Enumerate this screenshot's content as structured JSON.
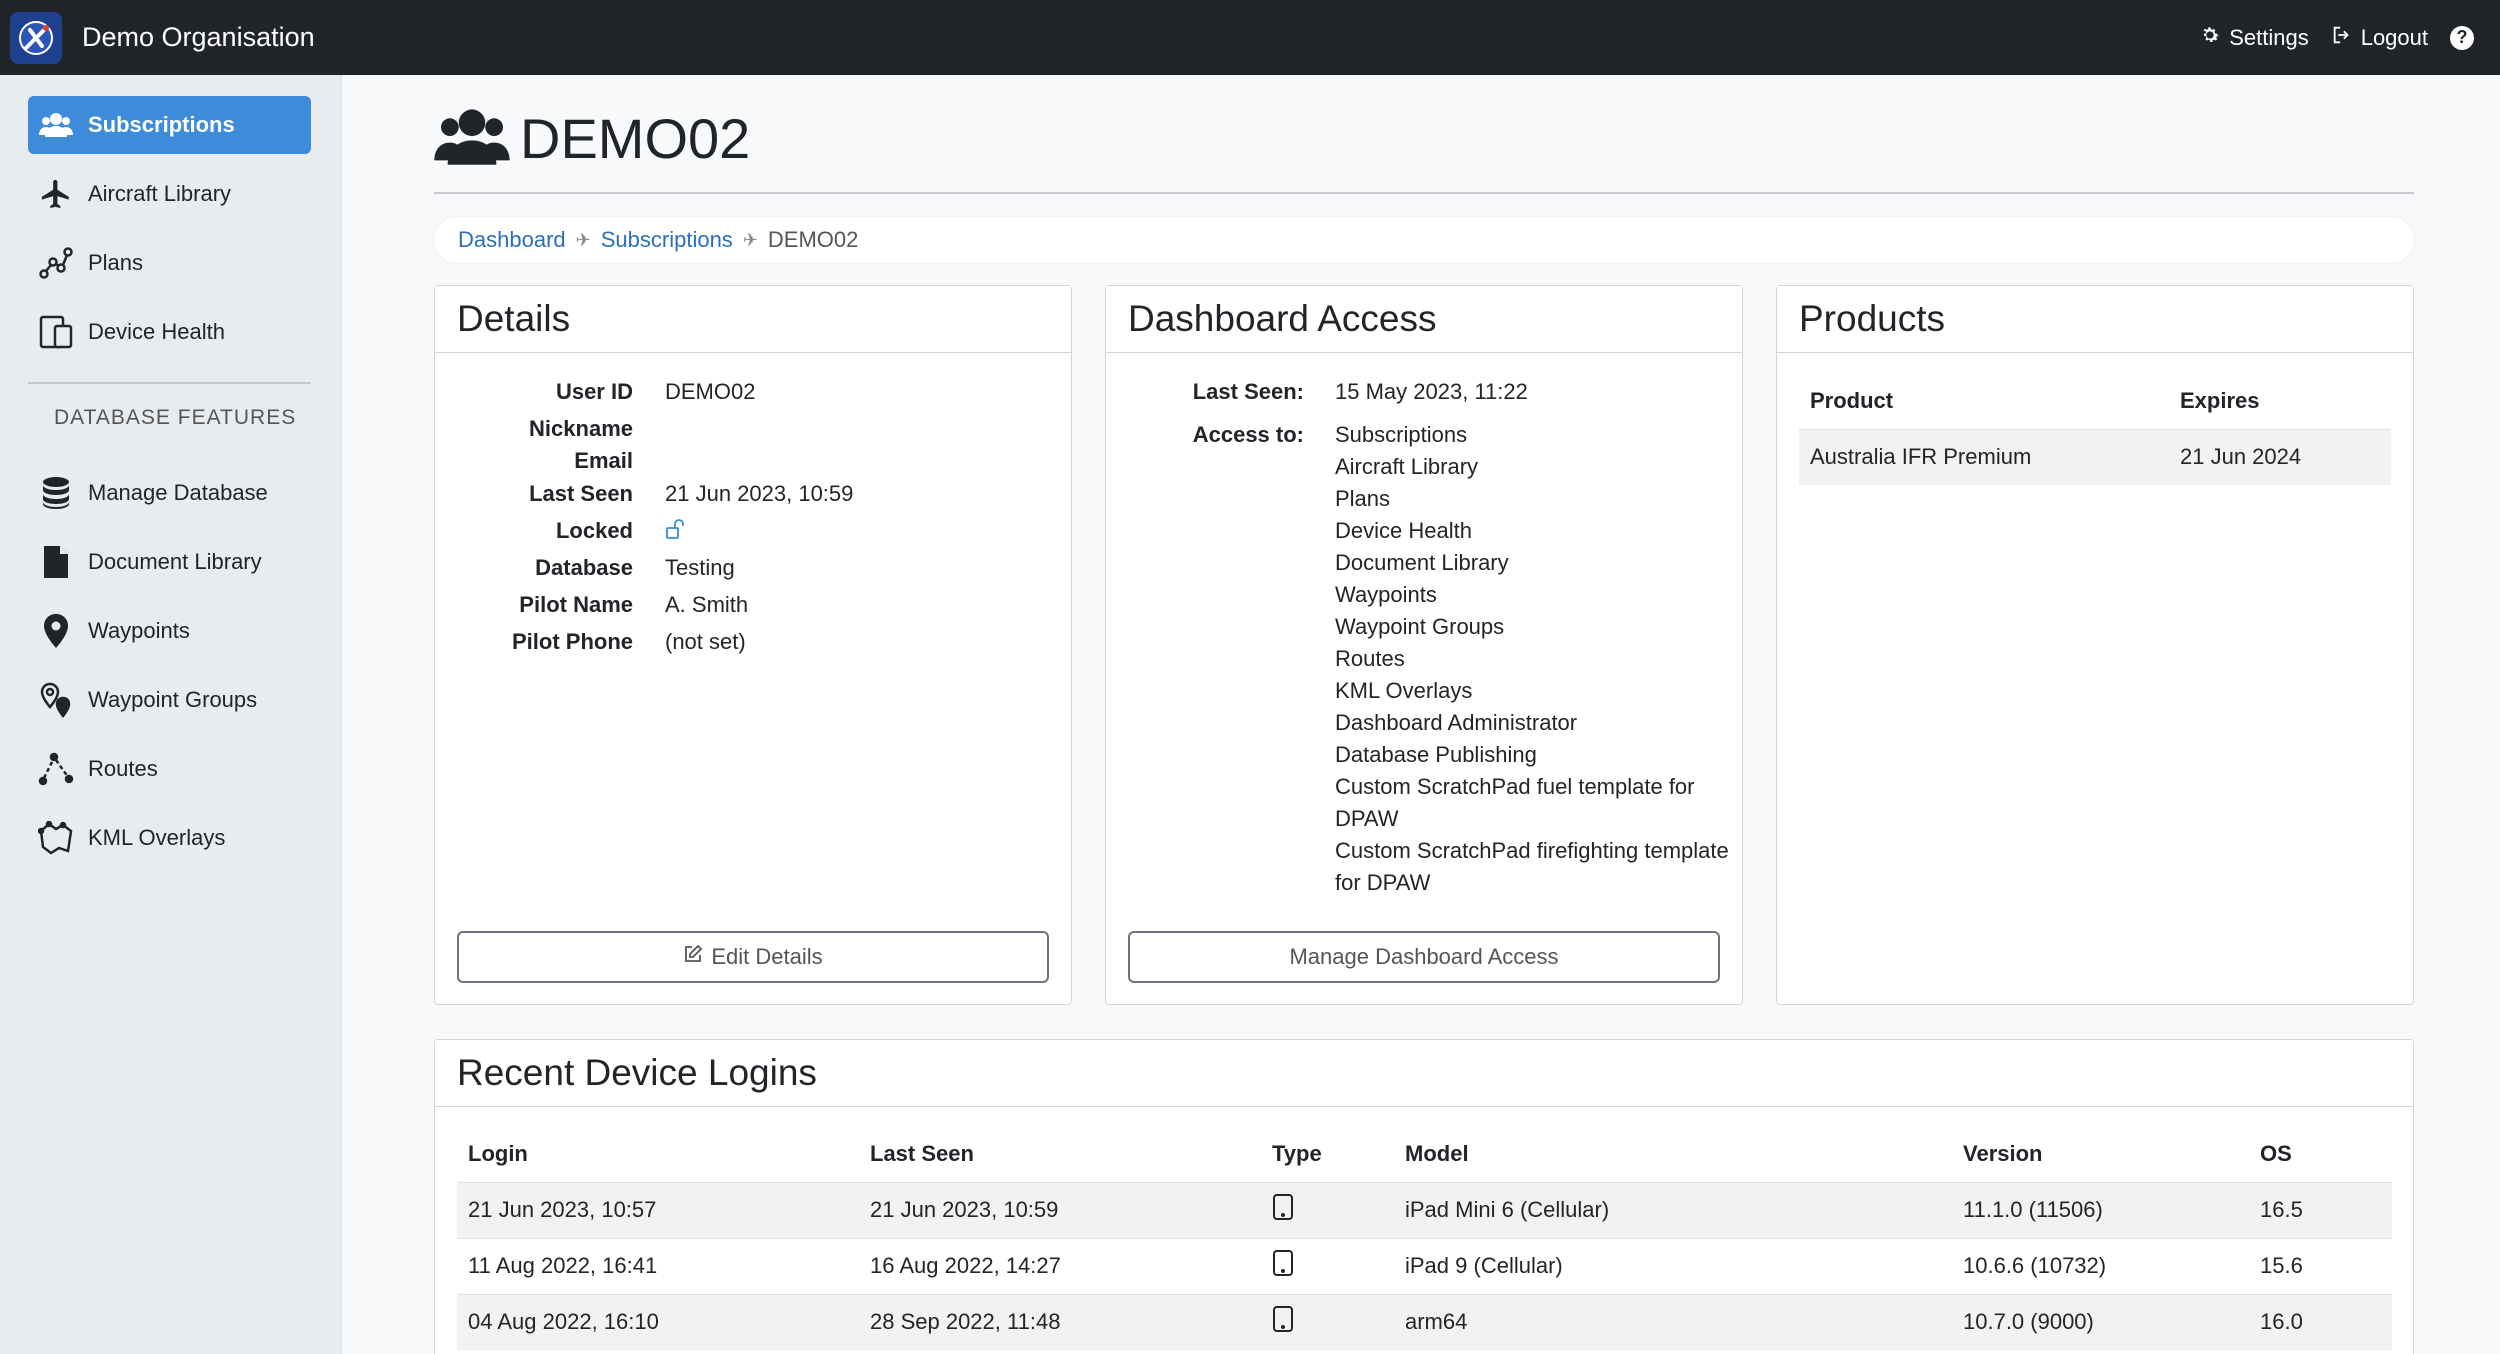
{
  "topbar": {
    "org_name": "Demo Organisation",
    "settings_label": "Settings",
    "logout_label": "Logout",
    "help_label": "?"
  },
  "sidebar": {
    "items": [
      {
        "label": "Subscriptions",
        "icon": "users-icon",
        "active": true
      },
      {
        "label": "Aircraft Library",
        "icon": "plane-icon"
      },
      {
        "label": "Plans",
        "icon": "plans-icon"
      },
      {
        "label": "Device Health",
        "icon": "devices-icon"
      }
    ],
    "section_heading": "DATABASE FEATURES",
    "db_items": [
      {
        "label": "Manage Database",
        "icon": "database-icon"
      },
      {
        "label": "Document Library",
        "icon": "document-icon"
      },
      {
        "label": "Waypoints",
        "icon": "map-pin-icon"
      },
      {
        "label": "Waypoint Groups",
        "icon": "map-pins-icon"
      },
      {
        "label": "Routes",
        "icon": "route-icon"
      },
      {
        "label": "KML Overlays",
        "icon": "map-overlay-icon"
      }
    ]
  },
  "page": {
    "title": "DEMO02",
    "breadcrumb": [
      "Dashboard",
      "Subscriptions",
      "DEMO02"
    ]
  },
  "details": {
    "header": "Details",
    "rows": [
      {
        "label": "User ID",
        "value": "DEMO02"
      },
      {
        "label": "Nickname",
        "value": ""
      },
      {
        "label": "Email",
        "value": ""
      },
      {
        "label": "Last Seen",
        "value": "21 Jun 2023, 10:59"
      },
      {
        "label": "Locked",
        "value": ""
      },
      {
        "label": "Database",
        "value": "Testing"
      },
      {
        "label": "Pilot Name",
        "value": "A. Smith"
      },
      {
        "label": "Pilot Phone",
        "value": "(not set)"
      }
    ],
    "edit_button": "Edit Details"
  },
  "dashboard_access": {
    "header": "Dashboard Access",
    "last_seen_label": "Last Seen:",
    "last_seen_value": "15 May 2023, 11:22",
    "access_label": "Access to:",
    "access_list": [
      "Subscriptions",
      "Aircraft Library",
      "Plans",
      "Device Health",
      "Document Library",
      "Waypoints",
      "Waypoint Groups",
      "Routes",
      "KML Overlays",
      "Dashboard Administrator",
      "Database Publishing",
      "Custom ScratchPad fuel template for DPAW",
      "Custom ScratchPad firefighting template for DPAW"
    ],
    "manage_button": "Manage Dashboard Access"
  },
  "products": {
    "header": "Products",
    "columns": [
      "Product",
      "Expires"
    ],
    "rows": [
      {
        "product": "Australia IFR Premium",
        "expires": "21 Jun 2024"
      }
    ]
  },
  "logins": {
    "header": "Recent Device Logins",
    "columns": [
      "Login",
      "Last Seen",
      "Type",
      "Model",
      "Version",
      "OS"
    ],
    "rows": [
      {
        "login": "21 Jun 2023, 10:57",
        "last_seen": "21 Jun 2023, 10:59",
        "type_icon": "tablet-icon",
        "model": "iPad Mini 6 (Cellular)",
        "version": "11.1.0 (11506)",
        "os": "16.5"
      },
      {
        "login": "11 Aug 2022, 16:41",
        "last_seen": "16 Aug 2022, 14:27",
        "type_icon": "tablet-icon",
        "model": "iPad 9 (Cellular)",
        "version": "10.6.6 (10732)",
        "os": "15.6"
      },
      {
        "login": "04 Aug 2022, 16:10",
        "last_seen": "28 Sep 2022, 11:48",
        "type_icon": "tablet-icon",
        "model": "arm64",
        "version": "10.7.0 (9000)",
        "os": "16.0"
      }
    ]
  },
  "colors": {
    "topbar_bg": "#212529",
    "sidebar_bg": "#e9ecef",
    "active_nav": "#3d8bd9",
    "link": "#2a6fba"
  }
}
